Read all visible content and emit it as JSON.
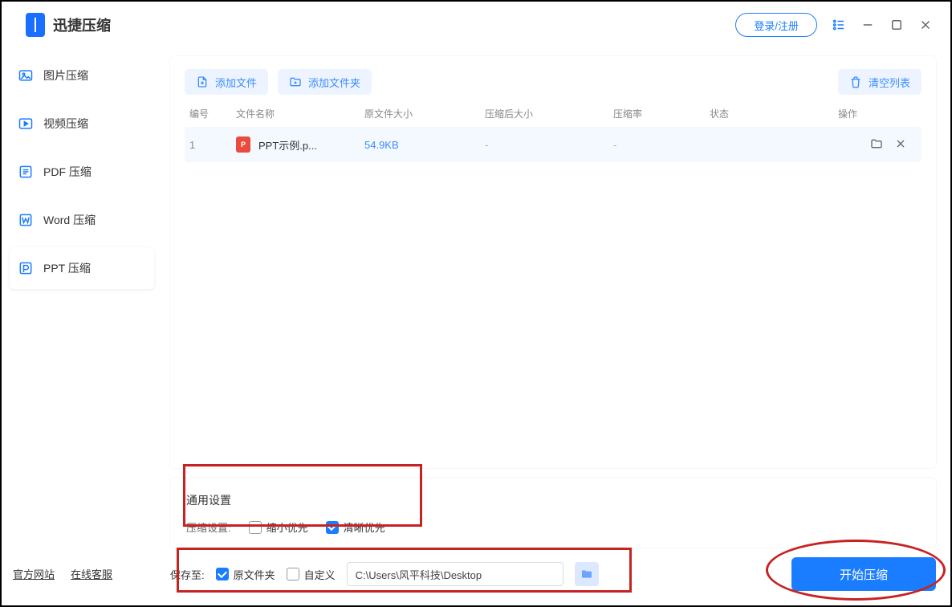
{
  "app": {
    "title": "迅捷压缩"
  },
  "header": {
    "login": "登录/注册"
  },
  "sidebar": {
    "items": [
      {
        "label": "图片压缩",
        "icon": "image"
      },
      {
        "label": "视频压缩",
        "icon": "video"
      },
      {
        "label": "PDF 压缩",
        "icon": "pdf"
      },
      {
        "label": "Word 压缩",
        "icon": "word"
      },
      {
        "label": "PPT 压缩",
        "icon": "ppt",
        "active": true
      }
    ],
    "footer": {
      "site": "官方网站",
      "support": "在线客服"
    }
  },
  "toolbar": {
    "add_file": "添加文件",
    "add_folder": "添加文件夹",
    "clear": "清空列表"
  },
  "table": {
    "cols": {
      "idx": "编号",
      "name": "文件名称",
      "size": "原文件大小",
      "after": "压缩后大小",
      "ratio": "压缩率",
      "status": "状态",
      "op": "操作"
    },
    "rows": [
      {
        "idx": "1",
        "name": "PPT示例.p...",
        "size": "54.9KB",
        "after": "-",
        "ratio": "-",
        "status": ""
      }
    ]
  },
  "settings": {
    "title": "通用设置",
    "label": "压缩设置:",
    "opt_small": "缩小优先",
    "opt_clear": "清晰优先"
  },
  "save": {
    "label": "保存至:",
    "opt_orig": "原文件夹",
    "opt_custom": "自定义",
    "path": "C:\\Users\\风平科技\\Desktop"
  },
  "start": "开始压缩"
}
